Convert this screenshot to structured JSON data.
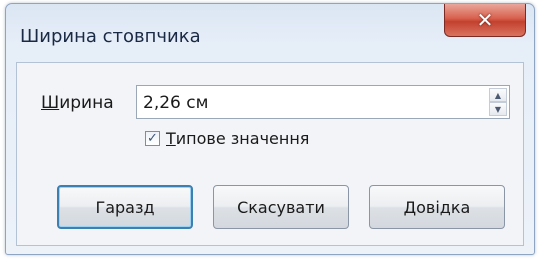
{
  "window": {
    "title": "Ширина стовпчика",
    "close_glyph": "✕"
  },
  "field": {
    "label_accel": "Ш",
    "label_rest": "ирина",
    "value": "2,26 см",
    "spin_up": "▲",
    "spin_down": "▼"
  },
  "checkbox": {
    "checked_glyph": "✓",
    "checked": true,
    "label_accel": "Т",
    "label_rest": "ипове значення"
  },
  "buttons": {
    "ok": "Гаразд",
    "cancel": "Скасувати",
    "help_accel": "Д",
    "help_rest": "овідка"
  }
}
